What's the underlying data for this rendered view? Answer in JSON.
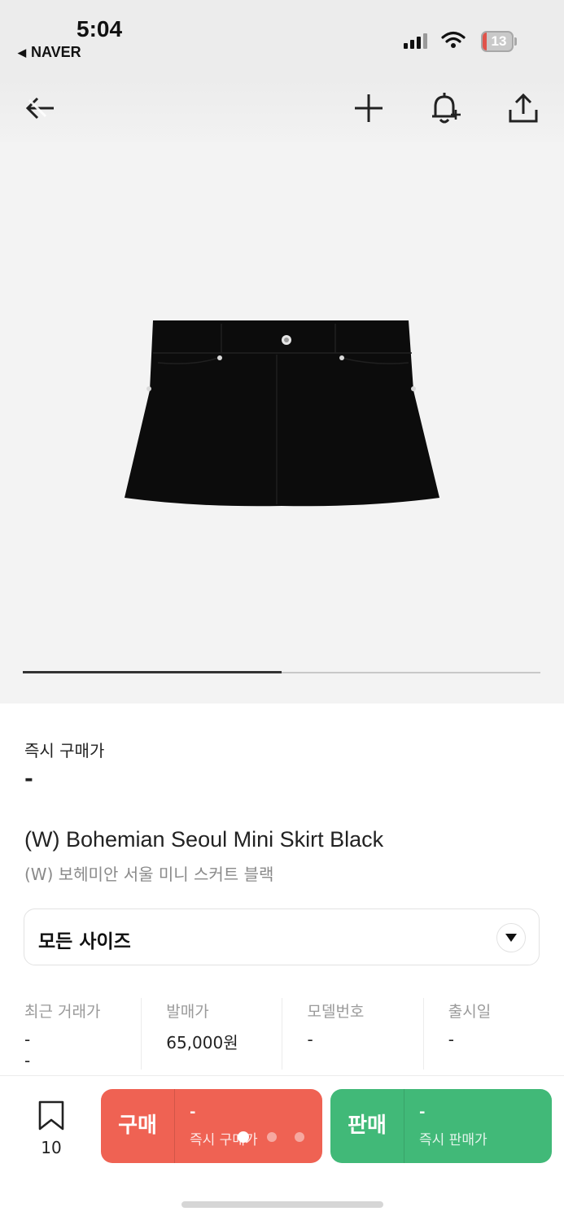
{
  "status_bar": {
    "time": "5:04",
    "back_app": "NAVER",
    "battery": "13",
    "battery_level": 0.13
  },
  "header": {
    "icons": [
      "back-icon",
      "plus-icon",
      "bell-plus-icon",
      "share-icon"
    ]
  },
  "product_image": {
    "alt": "black mini skirt",
    "progress": 0.5
  },
  "price": {
    "label": "즉시 구매가",
    "value": "-"
  },
  "product": {
    "title_en": "(W) Bohemian Seoul Mini Skirt Black",
    "title_ko": "(W) 보헤미안 서울 미니 스커트 블랙"
  },
  "size_select": {
    "label": "모든 사이즈"
  },
  "stats": [
    {
      "label": "최근 거래가",
      "value": "-",
      "value2": "-"
    },
    {
      "label": "발매가",
      "value": "65,000원"
    },
    {
      "label": "모델번호",
      "value": "-"
    },
    {
      "label": "출시일",
      "value": "-"
    }
  ],
  "bottom_bar": {
    "bookmark_count": "10",
    "buy": {
      "label": "구매",
      "price": "-",
      "sub": "즉시 구매가"
    },
    "sell": {
      "label": "판매",
      "price": "-",
      "sub": "즉시 판매가"
    }
  },
  "colors": {
    "buy": "#ef6253",
    "sell": "#41b978",
    "battery_low": "#e0534a"
  }
}
